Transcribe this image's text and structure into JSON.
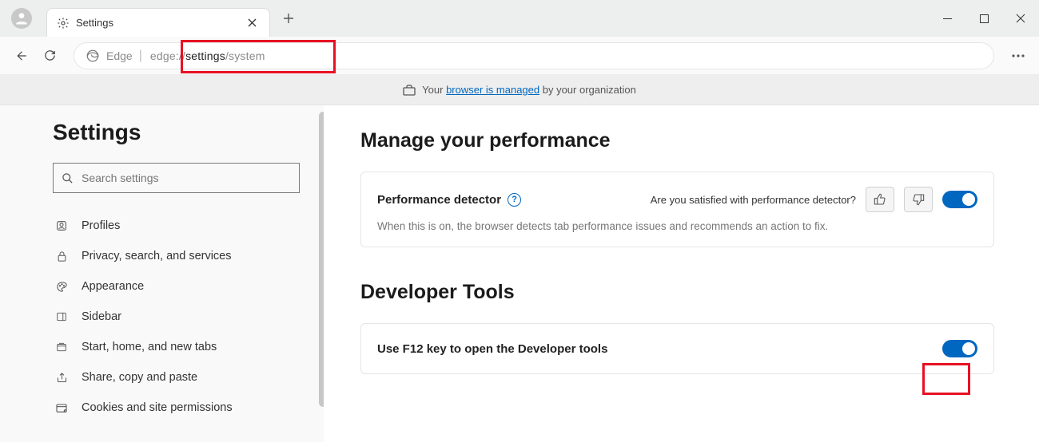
{
  "window": {
    "tab_title": "Settings",
    "minimize": "—",
    "maximize": "▢",
    "close": "✕"
  },
  "toolbar": {
    "brand": "Edge",
    "url_pre": "edge://",
    "url_em": "settings",
    "url_post": "/system"
  },
  "infostrip": {
    "prefix": "Your ",
    "link": "browser is managed",
    "suffix": " by your organization"
  },
  "sidebar": {
    "heading": "Settings",
    "search_placeholder": "Search settings",
    "items": [
      {
        "label": "Profiles"
      },
      {
        "label": "Privacy, search, and services"
      },
      {
        "label": "Appearance"
      },
      {
        "label": "Sidebar"
      },
      {
        "label": "Start, home, and new tabs"
      },
      {
        "label": "Share, copy and paste"
      },
      {
        "label": "Cookies and site permissions"
      }
    ]
  },
  "main": {
    "section1_heading": "Manage your performance",
    "perf_card": {
      "title": "Performance detector",
      "feedback_q": "Are you satisfied with performance detector?",
      "desc": "When this is on, the browser detects tab performance issues and recommends an action to fix."
    },
    "section2_heading": "Developer Tools",
    "f12_card": {
      "title": "Use F12 key to open the Developer tools"
    }
  }
}
